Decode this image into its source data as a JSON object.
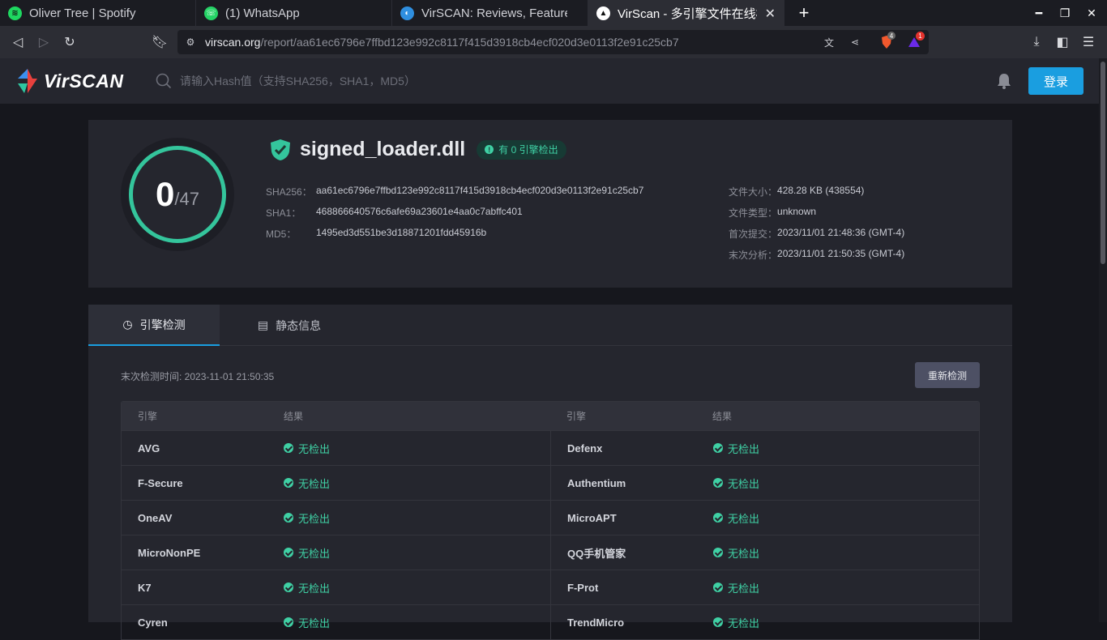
{
  "browser": {
    "tabs": [
      {
        "title": "Oliver Tree | Spotify",
        "icon": "spotify-icon",
        "color": "#1ed760",
        "active": false
      },
      {
        "title": "(1) WhatsApp",
        "icon": "whatsapp-icon",
        "color": "#25d366",
        "active": false
      },
      {
        "title": "VirSCAN: Reviews, Features, P",
        "icon": "virscan-favicon",
        "color": "#2f8fe0",
        "active": false
      },
      {
        "title": "VirScan - 多引擎文件在线检",
        "icon": "virscan-dark-favicon",
        "color": "#ffffff",
        "active": true
      }
    ],
    "url_host": "virscan.org",
    "url_path": "/report/aa61ec6796e7ffbd123e992c8117f415d3918cb4ecf020d3e0113f2e91c25cb7",
    "brave_badge": "4",
    "rewards_badge": "1"
  },
  "site": {
    "logo": "VirSCAN",
    "search_placeholder": "请输入Hash值（支持SHA256，SHA1，MD5）",
    "login_label": "登录"
  },
  "summary": {
    "detected": "0",
    "total": "/47",
    "file_name": "signed_loader.dll",
    "badge": "有 0 引擎检出",
    "hashes": [
      {
        "label": "SHA256：",
        "value": "aa61ec6796e7ffbd123e992c8117f415d3918cb4ecf020d3e0113f2e91c25cb7"
      },
      {
        "label": "SHA1：",
        "value": "468866640576c6afe69a23601e4aa0c7abffc401"
      },
      {
        "label": "MD5：",
        "value": "1495ed3d551be3d18871201fdd45916b"
      }
    ],
    "meta": [
      {
        "label": "文件大小：",
        "value": "428.28 KB (438554)"
      },
      {
        "label": "文件类型：",
        "value": "unknown"
      },
      {
        "label": "首次提交：",
        "value": "2023/11/01 21:48:36 (GMT-4)"
      },
      {
        "label": "末次分析：",
        "value": "2023/11/01 21:50:35 (GMT-4)"
      }
    ]
  },
  "panel": {
    "tabs": [
      "引擎检测",
      "静态信息"
    ],
    "last_scan": "末次检测时间: 2023-11-01 21:50:35",
    "rescan_label": "重新检测",
    "headers": {
      "engine": "引擎",
      "result": "结果"
    },
    "rows": [
      {
        "left": "AVG",
        "left_result": "无检出",
        "right": "Defenx",
        "right_result": "无检出"
      },
      {
        "left": "F-Secure",
        "left_result": "无检出",
        "right": "Authentium",
        "right_result": "无检出"
      },
      {
        "left": "OneAV",
        "left_result": "无检出",
        "right": "MicroAPT",
        "right_result": "无检出"
      },
      {
        "left": "MicroNonPE",
        "left_result": "无检出",
        "right": "QQ手机管家",
        "right_result": "无检出"
      },
      {
        "left": "K7",
        "left_result": "无检出",
        "right": "F-Prot",
        "right_result": "无检出"
      },
      {
        "left": "Cyren",
        "left_result": "无检出",
        "right": "TrendMicro",
        "right_result": "无检出"
      }
    ]
  },
  "colors": {
    "accent": "#1a9ee0",
    "clean": "#3fd0a4"
  }
}
